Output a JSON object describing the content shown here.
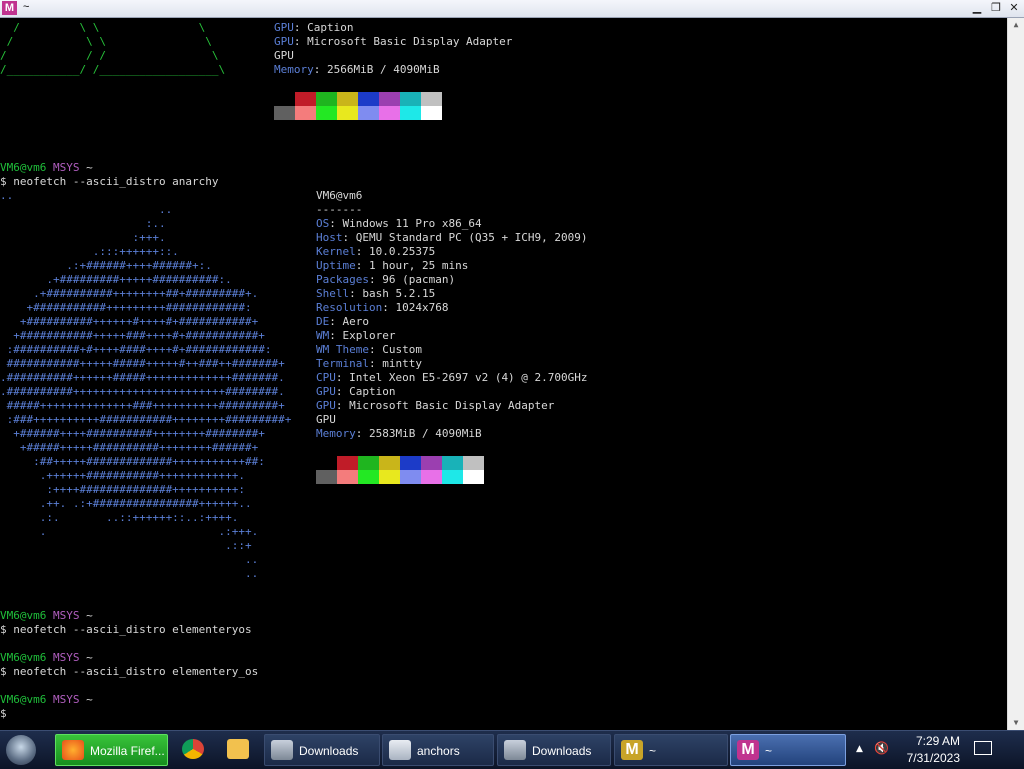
{
  "window": {
    "title": "~",
    "icon": "mintty-m-icon"
  },
  "tl": {
    "gpu1_label": "GPU",
    "gpu1_value": ": Caption",
    "gpu2_label": "GPU",
    "gpu2_value": ": Microsoft Basic Display Adapter",
    "gpu3": "GPU",
    "mem_label": "Memory",
    "mem_value": ": 2566MiB / 4090MiB",
    "ascii": [
      "  /         \\ \\               \\",
      " /           \\ \\               \\",
      "/            / /                \\",
      "/___________/ /__________________\\"
    ]
  },
  "colors": {
    "dark": [
      "#000000",
      "#c01c28",
      "#1fb51f",
      "#c9b51a",
      "#1c3bc8",
      "#9b3fb0",
      "#19b2b8",
      "#c0c0c0"
    ],
    "bright": [
      "#606060",
      "#f47c7c",
      "#23e823",
      "#e8e81e",
      "#7f8cf0",
      "#e870e8",
      "#1ee8e8",
      "#ffffff"
    ]
  },
  "terminal": {
    "block2": {
      "user": "VM6@vm6",
      "sys": "MSYS",
      "cwd": "~",
      "command": "$ neofetch --ascii_distro anarchy",
      "header": "VM6@vm6",
      "underline": "-------",
      "info": [
        {
          "label": "OS",
          "value": ": Windows 11 Pro x86_64"
        },
        {
          "label": "Host",
          "value": ": QEMU Standard PC (Q35 + ICH9, 2009)"
        },
        {
          "label": "Kernel",
          "value": ": 10.0.25375"
        },
        {
          "label": "Uptime",
          "value": ": 1 hour, 25 mins"
        },
        {
          "label": "Packages",
          "value": ": 96 (pacman)"
        },
        {
          "label": "Shell",
          "value": ": bash 5.2.15"
        },
        {
          "label": "Resolution",
          "value": ": 1024x768"
        },
        {
          "label": "DE",
          "value": ": Aero"
        },
        {
          "label": "WM",
          "value": ": Explorer"
        },
        {
          "label": "WM Theme",
          "value": ": Custom"
        },
        {
          "label": "Terminal",
          "value": ": mintty"
        },
        {
          "label": "CPU",
          "value": ": Intel Xeon E5-2697 v2 (4) @ 2.700GHz"
        },
        {
          "label": "GPU",
          "value": ": Caption"
        },
        {
          "label": "GPU",
          "value": ": Microsoft Basic Display Adapter"
        },
        {
          "label": "GPU",
          "value": ""
        },
        {
          "label": "Memory",
          "value": ": 2583MiB / 4090MiB"
        }
      ],
      "ascii": [
        "..",
        "                        ..",
        "                      :..",
        "                    :+++.",
        "              .:::++++++::.",
        "          .:+######++++######+:.",
        "       .+#########+++++##########:.",
        "     .+##########++++++++##+#########+.",
        "    +###########+++++++++############:",
        "   +##########++++++#++++#+###########+",
        "  +###########+++++###++++#+###########+",
        " :##########+#++++####++++#+############:",
        " ###########+++++#####+++++#++###++#######+",
        ".##########++++++#####+++++++++++++#######.",
        ".##########+++++++++++++++++++++++########.",
        " #####++++++++++++++###++++++++++#########+",
        " :###++++++++++###########++++++++#########+",
        "  +######++++##########++++++++########+",
        "   +#####+++++##########++++++++######+",
        "     :##+++++#############+++++++++++##:",
        "      .++++++###########++++++++++++.",
        "       :++++##############++++++++++:",
        "      .++. .:+################++++++..",
        "      .:.       ..::++++++::..:++++.",
        "      .                          .:+++.",
        "                                  .::+",
        "                                     ..",
        "                                     .."
      ]
    },
    "block3": {
      "user": "VM6@vm6",
      "sys": "MSYS",
      "cwd": "~",
      "command": "$ neofetch --ascii_distro elementeryos"
    },
    "block4": {
      "user": "VM6@vm6",
      "sys": "MSYS",
      "cwd": "~",
      "command": "$ neofetch --ascii_distro elementery_os"
    },
    "block5": {
      "user": "VM6@vm6",
      "sys": "MSYS",
      "cwd": "~",
      "command": "$"
    }
  },
  "taskbar": {
    "tasks": [
      {
        "label": "Mozilla Firef...",
        "icon": "firefox-icon"
      },
      {
        "label": "",
        "icon": "chrome-icon"
      },
      {
        "label": "",
        "icon": "folder-icon"
      },
      {
        "label": "Downloads",
        "icon": "downloads-icon"
      },
      {
        "label": "anchors",
        "icon": "notepad-icon"
      },
      {
        "label": "Downloads",
        "icon": "downloads-icon"
      },
      {
        "label": "~",
        "icon": "mintty-m-icon"
      },
      {
        "label": "~",
        "icon": "mintty-m-icon"
      }
    ],
    "clock_time": "7:29 AM",
    "clock_date": "7/31/2023"
  }
}
